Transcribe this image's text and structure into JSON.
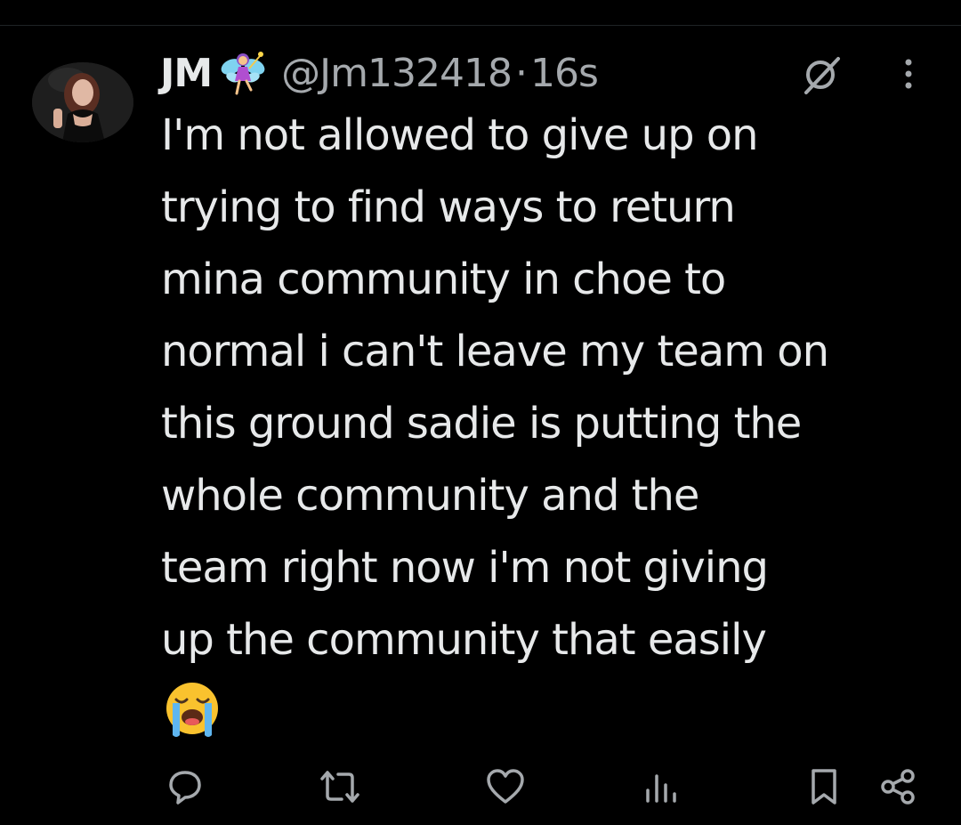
{
  "author": {
    "display_name": "JM",
    "name_emoji": "fairy-emoji",
    "handle": "@Jm132418",
    "separator": "·",
    "timestamp": "16s"
  },
  "header_icons": [
    "grok-icon",
    "more-options-icon"
  ],
  "tweet": {
    "text": "I'm not allowed to give up on\ntrying to find ways to return\nmina community in choe to\nnormal i can't leave my team on\nthis ground sadie is putting the\nwhole community and the\nteam right now i'm not giving\nup the community that easily",
    "trailing_emoji": "loudly-crying-face-emoji"
  },
  "actions": [
    "reply-icon",
    "repost-icon",
    "like-icon",
    "views-icon",
    "bookmark-icon",
    "share-icon"
  ],
  "colors": {
    "background": "#000000",
    "primary_text": "#e7e9ea",
    "secondary_text": "#a5a9ad",
    "icon": "#a5a9ad"
  }
}
